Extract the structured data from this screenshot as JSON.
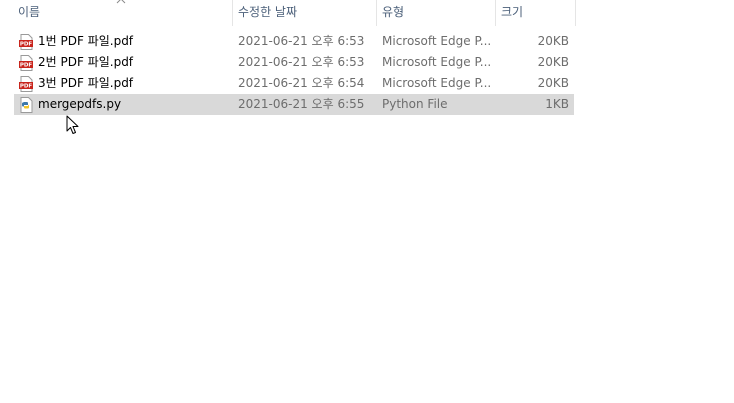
{
  "columns": {
    "name": "이름",
    "date": "수정한 날짜",
    "type": "유형",
    "size": "크기"
  },
  "files": [
    {
      "icon": "pdf-file-icon",
      "name": "1번 PDF 파일.pdf",
      "date": "2021-06-21 오후 6:53",
      "type": "Microsoft Edge P...",
      "size": "20KB",
      "selected": false
    },
    {
      "icon": "pdf-file-icon",
      "name": "2번 PDF 파일.pdf",
      "date": "2021-06-21 오후 6:53",
      "type": "Microsoft Edge P...",
      "size": "20KB",
      "selected": false
    },
    {
      "icon": "pdf-file-icon",
      "name": "3번 PDF 파일.pdf",
      "date": "2021-06-21 오후 6:54",
      "type": "Microsoft Edge P...",
      "size": "20KB",
      "selected": false
    },
    {
      "icon": "python-file-icon",
      "name": "mergepdfs.py",
      "date": "2021-06-21 오후 6:55",
      "type": "Python File",
      "size": "1KB",
      "selected": true
    }
  ],
  "colors": {
    "header_text": "#4c607a",
    "selection": "#d9d9d9",
    "pdf_red": "#c8241c"
  }
}
